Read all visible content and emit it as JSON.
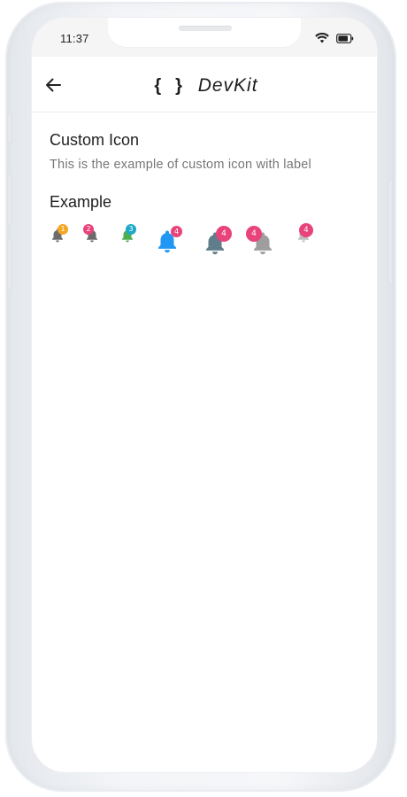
{
  "status_bar": {
    "time": "11:37",
    "wifi_icon": "wifi-icon",
    "battery_icon": "battery-icon"
  },
  "app_bar": {
    "back_icon": "arrow-left-icon",
    "title": "DevKit",
    "brace_open": "{",
    "brace_close": "}"
  },
  "content": {
    "title": "Custom Icon",
    "description": "This is the example of custom icon with label",
    "example_title": "Example"
  },
  "icons": [
    {
      "icon": "bell-icon",
      "label": "1",
      "bell_color": "#6b6b6b",
      "badge_color": "#f5a623"
    },
    {
      "icon": "bell-icon",
      "label": "2",
      "bell_color": "#6b6b6b",
      "badge_color": "#e8437a"
    },
    {
      "icon": "bell-icon",
      "label": "3",
      "bell_color": "#4caf50",
      "badge_color": "#1fa9c9"
    },
    {
      "icon": "bell-icon",
      "label": "4",
      "bell_color": "#2196f3",
      "badge_color": "#e8437a"
    },
    {
      "icon": "bell-icon",
      "label": "4",
      "bell_color": "#607d8b",
      "badge_color": "#e8437a"
    },
    {
      "icon": "bell-icon",
      "label": "4",
      "bell_color": "#9e9e9e",
      "badge_color": "#e8437a"
    },
    {
      "icon": "bell-icon",
      "label": "4",
      "bell_color": "#bdbdbd",
      "badge_color": "#e8437a"
    }
  ]
}
